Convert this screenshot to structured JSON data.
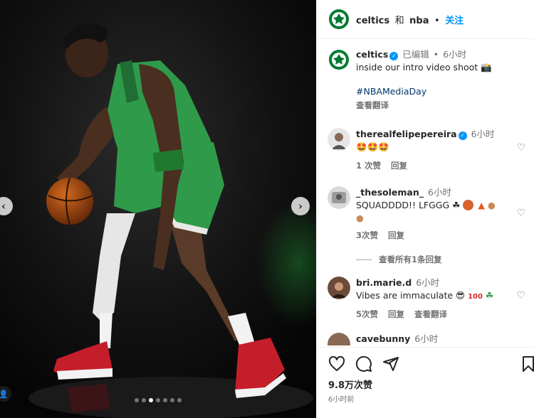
{
  "header": {
    "account1": "celtics",
    "joiner": "和",
    "account2": "nba",
    "dot": "•",
    "follow": "关注"
  },
  "caption": {
    "username": "celtics",
    "edited": "已编辑",
    "dot": "•",
    "time": "6小时",
    "text": "inside our intro video shoot 📸",
    "hashtag": "#NBAMediaDay",
    "translate": "查看翻译"
  },
  "comments": [
    {
      "username": "therealfelipepereira",
      "verified": true,
      "time": "6小时",
      "text": "🤩🤩🤩",
      "likes": "1 次赞",
      "reply": "回复"
    },
    {
      "username": "_thesoleman_",
      "verified": false,
      "time": "6小时",
      "text": "SQUADDDD!! LFGGG",
      "text_line2": "",
      "likes": "3次赞",
      "reply": "回复",
      "view_replies": "查看所有1条回复"
    },
    {
      "username": "bri.marie.d",
      "verified": false,
      "time": "6小时",
      "text": "Vibes are immaculate",
      "likes": "5次赞",
      "reply": "回复",
      "translate": "查看翻译"
    },
    {
      "username": "cavebunny",
      "verified": false,
      "time": "6小时"
    }
  ],
  "footer": {
    "likes": "9.8万次赞",
    "time": "6小时前"
  },
  "media": {
    "slide_count": 7,
    "active_slide": 3
  },
  "colors": {
    "accent": "#0095f6",
    "celtics_green": "#007a33",
    "jersey_green": "#2f9b4a"
  }
}
